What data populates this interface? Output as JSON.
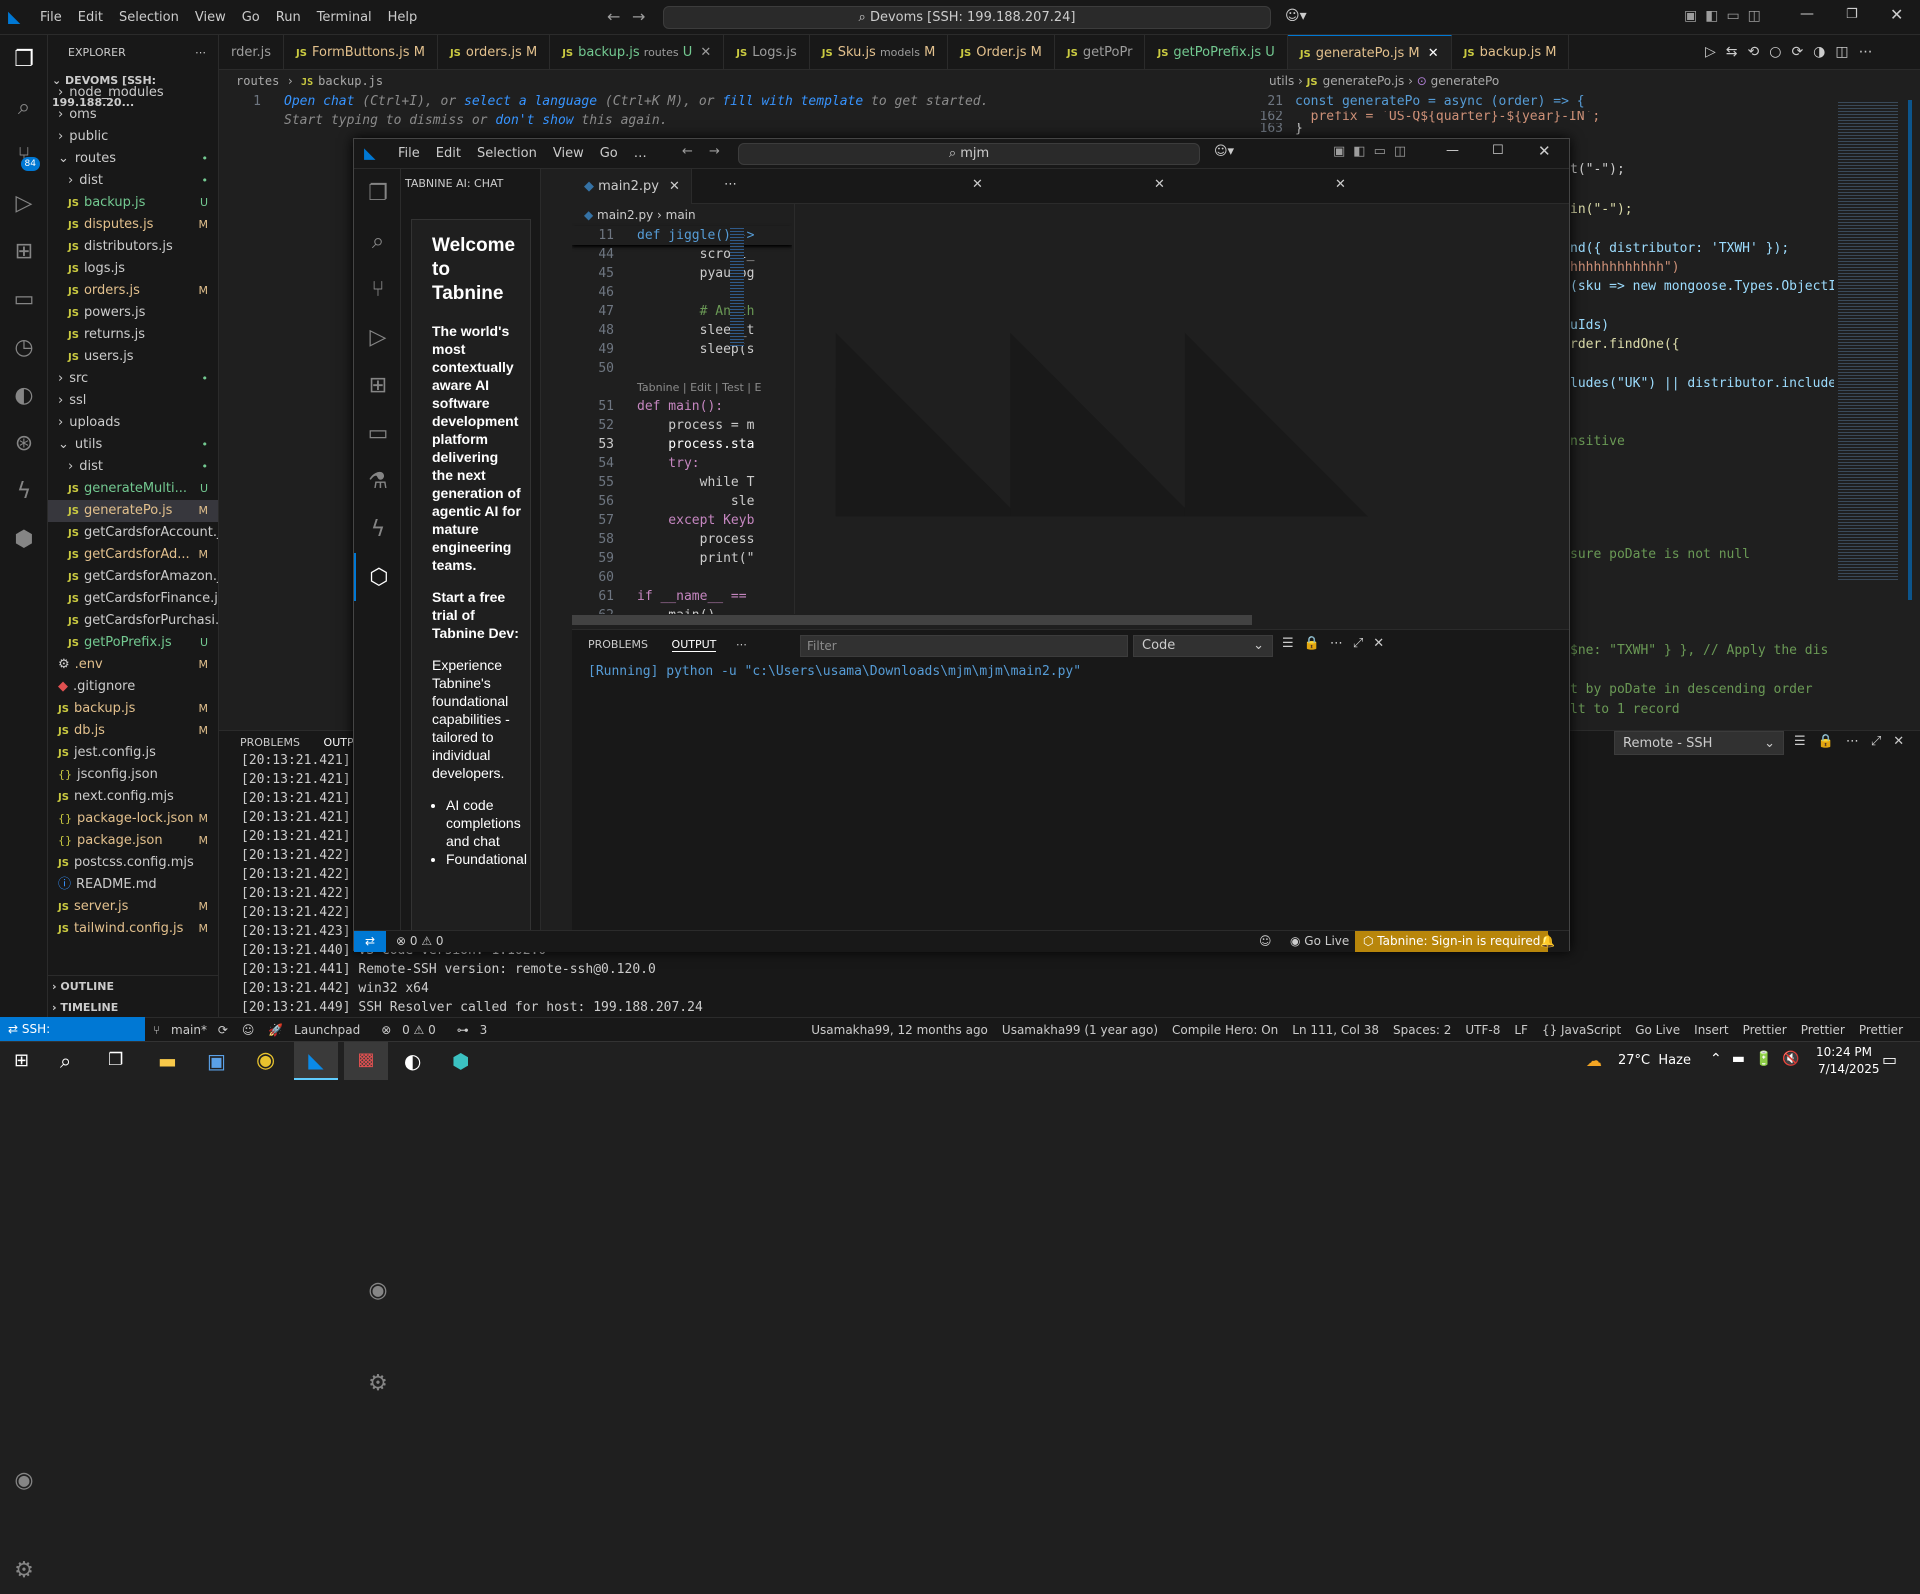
{
  "titlebar": {
    "menus": [
      "File",
      "Edit",
      "Selection",
      "View",
      "Go",
      "Run",
      "Terminal",
      "Help"
    ],
    "search": "Devoms [SSH: 199.188.207.24]"
  },
  "explorer": {
    "header": "EXPLORER",
    "root": "DEVOMS [SSH: 199.188.20...",
    "items": [
      {
        "label": "node_modules",
        "kind": "folder",
        "depth": 1,
        "status": ""
      },
      {
        "label": "oms",
        "kind": "folder",
        "depth": 1,
        "status": ""
      },
      {
        "label": "public",
        "kind": "folder",
        "depth": 1,
        "status": ""
      },
      {
        "label": "routes",
        "kind": "folder-open",
        "depth": 1,
        "status": "•"
      },
      {
        "label": "dist",
        "kind": "folder",
        "depth": 2,
        "status": "•"
      },
      {
        "label": "backup.js",
        "kind": "js",
        "depth": 2,
        "status": "U"
      },
      {
        "label": "disputes.js",
        "kind": "js",
        "depth": 2,
        "status": "M"
      },
      {
        "label": "distributors.js",
        "kind": "js",
        "depth": 2,
        "status": ""
      },
      {
        "label": "logs.js",
        "kind": "js",
        "depth": 2,
        "status": ""
      },
      {
        "label": "orders.js",
        "kind": "js",
        "depth": 2,
        "status": "M"
      },
      {
        "label": "powers.js",
        "kind": "js",
        "depth": 2,
        "status": ""
      },
      {
        "label": "returns.js",
        "kind": "js",
        "depth": 2,
        "status": ""
      },
      {
        "label": "users.js",
        "kind": "js",
        "depth": 2,
        "status": ""
      },
      {
        "label": "src",
        "kind": "folder",
        "depth": 1,
        "status": "•"
      },
      {
        "label": "ssl",
        "kind": "folder",
        "depth": 1,
        "status": ""
      },
      {
        "label": "uploads",
        "kind": "folder",
        "depth": 1,
        "status": ""
      },
      {
        "label": "utils",
        "kind": "folder-open",
        "depth": 1,
        "status": "•"
      },
      {
        "label": "dist",
        "kind": "folder",
        "depth": 2,
        "status": "•"
      },
      {
        "label": "generateMulti...",
        "kind": "js",
        "depth": 2,
        "status": "U"
      },
      {
        "label": "generatePo.js",
        "kind": "js",
        "depth": 2,
        "status": "M",
        "selected": true
      },
      {
        "label": "getCardsforAccount.js",
        "kind": "js",
        "depth": 2,
        "status": ""
      },
      {
        "label": "getCardsforAd...",
        "kind": "js",
        "depth": 2,
        "status": "M"
      },
      {
        "label": "getCardsforAmazon.js",
        "kind": "js",
        "depth": 2,
        "status": ""
      },
      {
        "label": "getCardsforFinance.js",
        "kind": "js",
        "depth": 2,
        "status": ""
      },
      {
        "label": "getCardsforPurchasi...",
        "kind": "js",
        "depth": 2,
        "status": ""
      },
      {
        "label": "getPoPrefix.js",
        "kind": "js",
        "depth": 2,
        "status": "U"
      },
      {
        "label": ".env",
        "kind": "gear",
        "depth": 1,
        "status": "M"
      },
      {
        "label": ".gitignore",
        "kind": "git",
        "depth": 1,
        "status": ""
      },
      {
        "label": "backup.js",
        "kind": "js",
        "depth": 1,
        "status": "M"
      },
      {
        "label": "db.js",
        "kind": "js",
        "depth": 1,
        "status": "M"
      },
      {
        "label": "jest.config.js",
        "kind": "js",
        "depth": 1,
        "status": ""
      },
      {
        "label": "jsconfig.json",
        "kind": "json",
        "depth": 1,
        "status": ""
      },
      {
        "label": "next.config.mjs",
        "kind": "js",
        "depth": 1,
        "status": ""
      },
      {
        "label": "package-lock.json",
        "kind": "json",
        "depth": 1,
        "status": "M"
      },
      {
        "label": "package.json",
        "kind": "json",
        "depth": 1,
        "status": "M"
      },
      {
        "label": "postcss.config.mjs",
        "kind": "js",
        "depth": 1,
        "status": ""
      },
      {
        "label": "README.md",
        "kind": "info",
        "depth": 1,
        "status": ""
      },
      {
        "label": "server.js",
        "kind": "js",
        "depth": 1,
        "status": "M"
      },
      {
        "label": "tailwind.config.js",
        "kind": "js",
        "depth": 1,
        "status": "M"
      }
    ],
    "outline": "OUTLINE",
    "timeline": "TIMELINE"
  },
  "tabs": [
    {
      "label": "rder.js",
      "status": ""
    },
    {
      "label": "FormButtons.js",
      "status": "M"
    },
    {
      "label": "orders.js",
      "status": "M"
    },
    {
      "label": "backup.js",
      "desc": "routes",
      "status": "U"
    },
    {
      "label": "Logs.js",
      "status": ""
    },
    {
      "label": "Sku.js",
      "desc": "models",
      "status": "M"
    },
    {
      "label": "Order.js",
      "status": "M"
    },
    {
      "label": "getPoPr",
      "status": ""
    },
    {
      "label": "getPoPrefix.js",
      "status": "U"
    },
    {
      "label": "generatePo.js",
      "status": "M",
      "active": true
    },
    {
      "label": "backup.js",
      "status": "M"
    }
  ],
  "editorA": {
    "breadcrumb": [
      "routes",
      "backup.js"
    ],
    "line_no": "1",
    "hint_parts": [
      "Open chat",
      " (Ctrl+I), or ",
      "select a language",
      " (Ctrl+K M), or ",
      "fill with template",
      " to get started."
    ],
    "hint2_parts": [
      "Start typing to dismiss or ",
      "don't show",
      " this again."
    ]
  },
  "editorB": {
    "breadcrumb": [
      "utils",
      "generatePo.js",
      "generatePo"
    ],
    "lines": [
      {
        "n": "21",
        "text": "const generatePo = async (order) => {"
      },
      {
        "n": "162",
        "text": "  prefix = `US-Q${quarter}-${year}-IN`;"
      },
      {
        "n": "163",
        "text": "}"
      }
    ],
    "fragments": [
      "t(\"-\");",
      "in(\"-\");",
      "nd({ distributor: 'TXWH' });",
      "hhhhhhhhhhhh\")",
      "(sku => new mongoose.Types.ObjectI",
      "uIds)",
      "rder.findOne({",
      "ludes(\"UK\") || distributor.include",
      "nsitive",
      "sure poDate is not null",
      "$ne: \"TXWH\" } }, // Apply the dis",
      "t by poDate in descending order",
      "lt to 1 record"
    ]
  },
  "bottom": {
    "tabs": [
      "PROBLEMS",
      "OUTPU"
    ],
    "select": "Remote - SSH",
    "log": [
      "[20:13:21.421]",
      "[20:13:21.421]",
      "[20:13:21.421]",
      "[20:13:21.421]",
      "[20:13:21.421]",
      "[20:13:21.422]",
      "[20:13:21.422]",
      "[20:13:21.422]",
      "[20:13:21.422]",
      "[20:13:21.423]",
      "[20:13:21.440] VS Code version: 1.102.0",
      "[20:13:21.441] Remote-SSH version: remote-ssh@0.120.0",
      "[20:13:21.442] win32 x64",
      "[20:13:21.449] SSH Resolver called for host: 199.188.207.24"
    ]
  },
  "status": {
    "remote": "SSH: 199.188.207.24",
    "branch": "main*",
    "launchpad": "Launchpad",
    "problems": "0 ⚠ 0",
    "ports": "3",
    "right": [
      "Usamakha99, 12 months ago",
      "Usamakha99 (1 year ago)",
      "Compile Hero: On",
      "Ln 111, Col 38",
      "Spaces: 2",
      "UTF-8",
      "LF",
      "{} JavaScript",
      "Go Live",
      "Insert",
      "Prettier",
      "Prettier",
      "Prettier"
    ]
  },
  "front": {
    "menus": [
      "File",
      "Edit",
      "Selection",
      "View",
      "Go",
      "…"
    ],
    "search": "mjm",
    "chat_header": "TABNINE AI: CHAT",
    "welcome": {
      "title": "Welcome to Tabnine",
      "p1": "The world's most contextually aware AI software development platform delivering the next generation of agentic AI for mature engineering teams.",
      "p2": "Start a free trial of Tabnine Dev:",
      "p3": "Experience Tabnine's foundational capabilities - tailored to individual developers.",
      "bullets": [
        "AI code completions and chat",
        "Foundational"
      ]
    },
    "tab": "main2.py",
    "breadcrumb": [
      "main2.py",
      "main"
    ],
    "sticky": {
      "n": "11",
      "text": "def jiggle() ->"
    },
    "code": [
      {
        "n": "44",
        "text": "        scroll_"
      },
      {
        "n": "45",
        "text": "        pyautog"
      },
      {
        "n": "46",
        "text": ""
      },
      {
        "n": "47",
        "text": "        # Anoth"
      },
      {
        "n": "48",
        "text": "        sleep_t"
      },
      {
        "n": "49",
        "text": "        sleep(s"
      },
      {
        "n": "50",
        "text": ""
      },
      {
        "n": "",
        "text": "Tabnine | Edit | Test | E"
      },
      {
        "n": "51",
        "text": "def main():"
      },
      {
        "n": "52",
        "text": "    process = m"
      },
      {
        "n": "53",
        "text": "    process.sta"
      },
      {
        "n": "54",
        "text": "    try:"
      },
      {
        "n": "55",
        "text": "        while T"
      },
      {
        "n": "56",
        "text": "            sle"
      },
      {
        "n": "57",
        "text": "    except Keyb"
      },
      {
        "n": "58",
        "text": "        process"
      },
      {
        "n": "59",
        "text": "        print(\""
      },
      {
        "n": "60",
        "text": ""
      },
      {
        "n": "61",
        "text": "if __name__ =="
      },
      {
        "n": "62",
        "text": "    main()"
      }
    ],
    "panel_tabs": [
      "PROBLEMS",
      "OUTPUT"
    ],
    "filter_placeholder": "Filter",
    "channel": "Code",
    "output": "[Running] python -u \"c:\\Users\\usama\\Downloads\\mjm\\mjm\\main2.py\"",
    "status": {
      "problems": "0 ⚠ 0",
      "go_live": "Go Live",
      "tabnine": "Tabnine: Sign-in is required"
    }
  },
  "taskbar": {
    "weather": "27°C  Haze",
    "time": "10:24 PM",
    "date": "7/14/2025"
  }
}
